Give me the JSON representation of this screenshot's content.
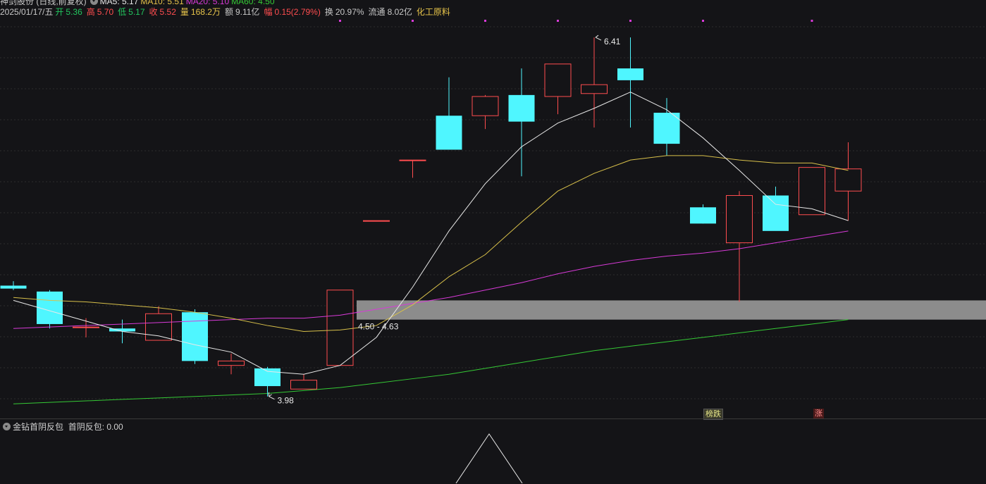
{
  "header": {
    "title": "神剑股份 (日线,前复权)",
    "ma5": "MA5: 5.17",
    "ma10": "MA10: 5.51",
    "ma20": "MA20: 5.10",
    "ma60": "MA60: 4.50",
    "date": "2025/01/17/五",
    "open_label": "开",
    "open": "5.36",
    "high_label": "高",
    "high": "5.70",
    "low_label": "低",
    "low": "5.17",
    "close_label": "收",
    "close": "5.52",
    "vol_label": "量",
    "vol": "168.2万",
    "amt_label": "额",
    "amt": "9.11亿",
    "chg_label": "幅",
    "chg": "0.15(2.79%)",
    "turn_label": "换",
    "turn": "20.97%",
    "float_label": "流通",
    "float": "8.02亿",
    "sector": "化工原料"
  },
  "annotations": {
    "high_mark": "6.41",
    "low_mark": "3.98",
    "zone": "4.50 - 4.63"
  },
  "badges": {
    "b1": "榜跌",
    "b2": "涨"
  },
  "indicator": {
    "name": "金钻首阴反包",
    "value_label": "首阴反包: 0.00"
  },
  "colors": {
    "up": "#ff4d4f",
    "down": "#4ff6ff",
    "ma5": "#e8e8e8",
    "ma10": "#d8c04a",
    "ma20": "#d83ad8",
    "ma60": "#35c935",
    "zone": "#8c8c8c"
  },
  "chart_data": {
    "type": "candlestick",
    "candles": [
      {
        "o": 4.73,
        "h": 4.76,
        "l": 4.7,
        "c": 4.71
      },
      {
        "o": 4.69,
        "h": 4.7,
        "l": 4.44,
        "c": 4.47
      },
      {
        "o": 4.45,
        "h": 4.51,
        "l": 4.38,
        "c": 4.45
      },
      {
        "o": 4.44,
        "h": 4.5,
        "l": 4.34,
        "c": 4.42
      },
      {
        "o": 4.36,
        "h": 4.59,
        "l": 4.36,
        "c": 4.54
      },
      {
        "o": 4.55,
        "h": 4.57,
        "l": 4.2,
        "c": 4.22
      },
      {
        "o": 4.19,
        "h": 4.27,
        "l": 4.13,
        "c": 4.22
      },
      {
        "o": 4.17,
        "h": 4.18,
        "l": 3.98,
        "c": 4.05
      },
      {
        "o": 4.03,
        "h": 4.13,
        "l": 4.03,
        "c": 4.09
      },
      {
        "o": 4.19,
        "h": 4.7,
        "l": 4.19,
        "c": 4.7
      },
      {
        "o": 5.17,
        "h": 5.17,
        "l": 5.17,
        "c": 5.17
      },
      {
        "o": 5.58,
        "h": 5.58,
        "l": 5.46,
        "c": 5.58
      },
      {
        "o": 5.88,
        "h": 6.14,
        "l": 5.65,
        "c": 5.65
      },
      {
        "o": 5.88,
        "h": 6.02,
        "l": 5.79,
        "c": 6.01
      },
      {
        "o": 6.02,
        "h": 6.2,
        "l": 5.47,
        "c": 5.84
      },
      {
        "o": 6.01,
        "h": 6.23,
        "l": 5.89,
        "c": 6.23
      },
      {
        "o": 6.03,
        "h": 6.41,
        "l": 5.8,
        "c": 6.09
      },
      {
        "o": 6.2,
        "h": 6.41,
        "l": 5.8,
        "c": 6.12
      },
      {
        "o": 5.9,
        "h": 6.0,
        "l": 5.61,
        "c": 5.69
      },
      {
        "o": 5.26,
        "h": 5.28,
        "l": 5.15,
        "c": 5.15
      },
      {
        "o": 5.02,
        "h": 5.37,
        "l": 4.62,
        "c": 5.34
      },
      {
        "o": 5.34,
        "h": 5.4,
        "l": 5.11,
        "c": 5.1
      },
      {
        "o": 5.21,
        "h": 5.53,
        "l": 5.21,
        "c": 5.53
      },
      {
        "o": 5.37,
        "h": 5.7,
        "l": 5.17,
        "c": 5.52
      }
    ],
    "ma5": [
      4.63,
      4.56,
      4.49,
      4.42,
      4.39,
      4.33,
      4.28,
      4.15,
      4.13,
      4.19,
      4.38,
      4.72,
      5.1,
      5.42,
      5.67,
      5.83,
      5.93,
      6.04,
      5.92,
      5.73,
      5.51,
      5.28,
      5.25,
      5.17
    ],
    "ma10": [
      4.65,
      4.63,
      4.62,
      4.6,
      4.58,
      4.55,
      4.51,
      4.46,
      4.42,
      4.43,
      4.46,
      4.6,
      4.79,
      4.94,
      5.16,
      5.37,
      5.49,
      5.58,
      5.61,
      5.61,
      5.58,
      5.56,
      5.56,
      5.51
    ],
    "ma20": [
      4.44,
      4.45,
      4.46,
      4.47,
      4.48,
      4.49,
      4.5,
      4.51,
      4.51,
      4.53,
      4.57,
      4.61,
      4.65,
      4.7,
      4.75,
      4.81,
      4.86,
      4.9,
      4.93,
      4.95,
      4.98,
      5.02,
      5.06,
      5.1
    ],
    "ma60": [
      3.93,
      3.94,
      3.95,
      3.96,
      3.97,
      3.98,
      3.99,
      4.0,
      4.02,
      4.04,
      4.07,
      4.1,
      4.13,
      4.17,
      4.21,
      4.25,
      4.29,
      4.32,
      4.35,
      4.38,
      4.41,
      4.44,
      4.47,
      4.5
    ],
    "zone": [
      4.5,
      4.63
    ],
    "ylim": [
      3.85,
      6.52
    ]
  }
}
